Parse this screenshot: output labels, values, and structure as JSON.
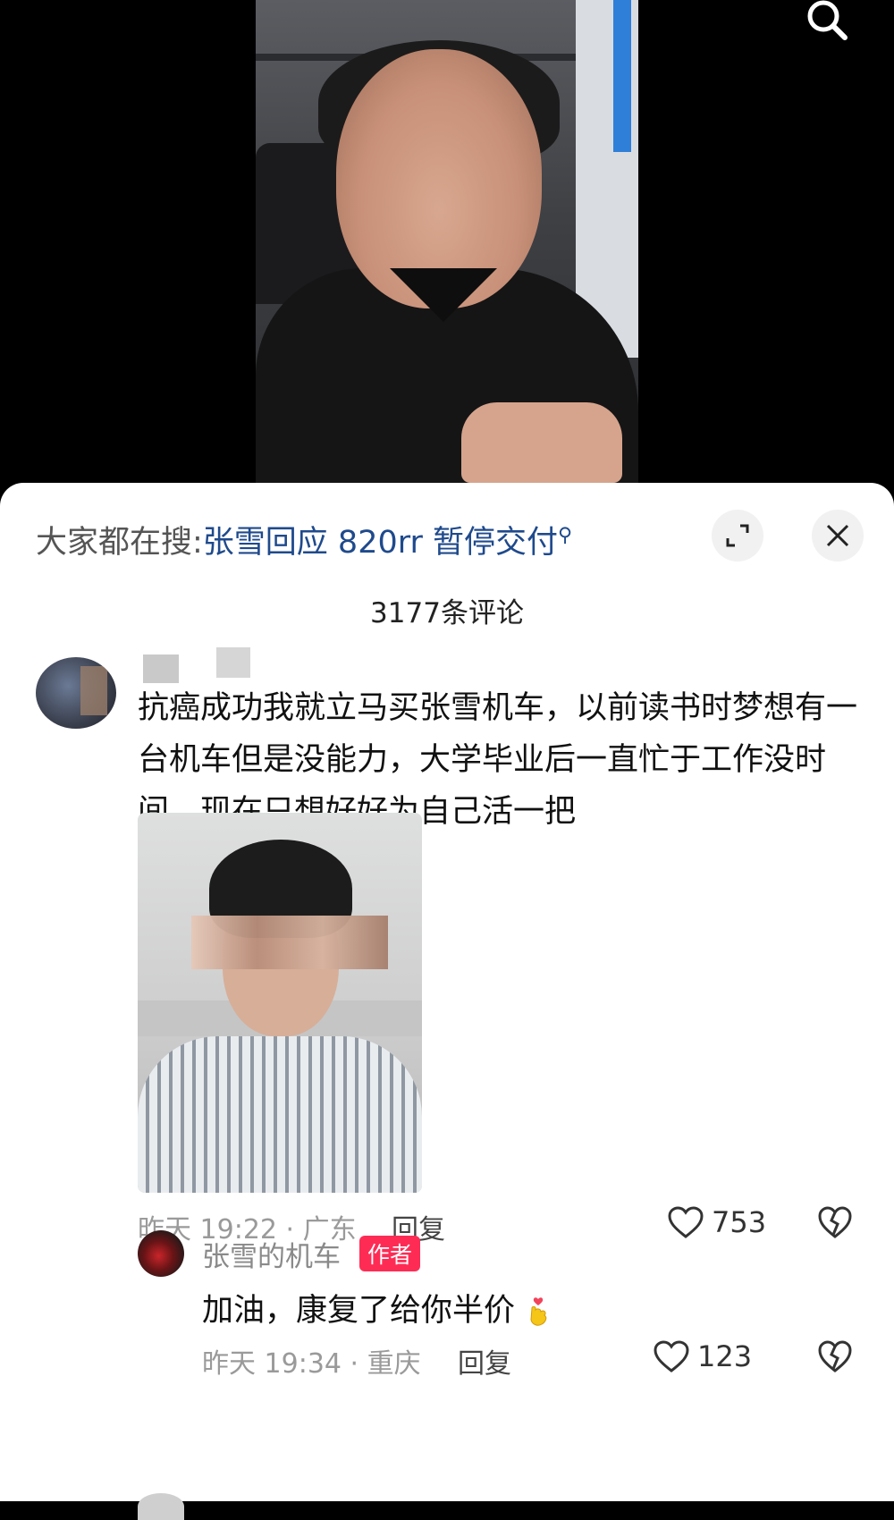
{
  "trending": {
    "prefix": "大家都在搜:",
    "query": "张雪回应 820rr 暂停交付"
  },
  "comments_count": "3177条评论",
  "comment": {
    "text": "抗癌成功我就立马买张雪机车，以前读书时梦想有一台机车但是没能力，大学毕业后一直忙于工作没时间，现在只想好好为自己活一把",
    "time_location": "昨天 19:22 · 广东",
    "reply_label": "回复",
    "likes": "753"
  },
  "author_reply": {
    "name": "张雪的机车",
    "badge": "作者",
    "text": "加油，康复了给你半价",
    "time_location": "昨天 19:34 · 重庆",
    "reply_label": "回复",
    "likes": "123"
  },
  "icons": [
    "search-icon",
    "expand-icon",
    "close-icon",
    "heart-icon",
    "dislike-heart-icon"
  ],
  "colors": {
    "link": "#1f4a8c",
    "badge": "#fe2c55"
  }
}
